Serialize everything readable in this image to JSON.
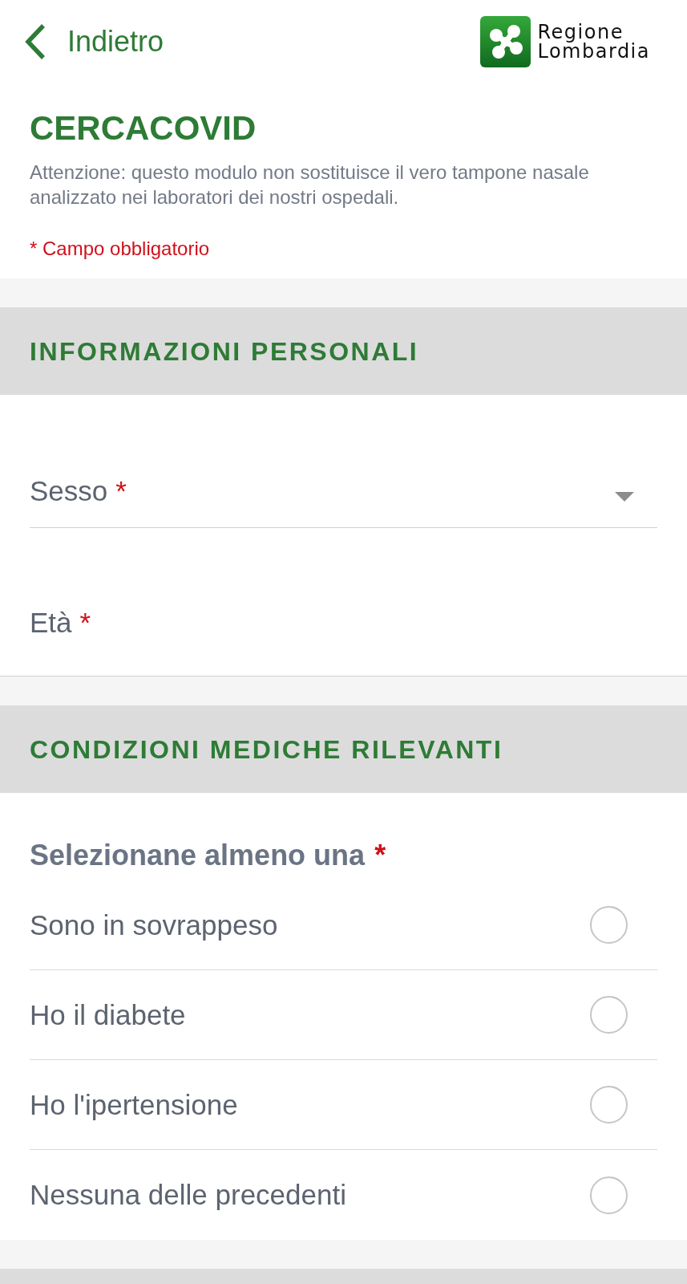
{
  "header": {
    "back_label": "Indietro",
    "logo_lines": [
      "Regione",
      "Lombardia"
    ]
  },
  "intro": {
    "title": "CERCACOVID",
    "notice": "Attenzione: questo modulo non sostituisce il vero tampone nasale analizzato nei laboratori dei nostri ospedali.",
    "required_note": "* Campo obbligatorio"
  },
  "sections": [
    {
      "title": "INFORMAZIONI PERSONALI",
      "fields": [
        {
          "kind": "select",
          "label": "Sesso",
          "required_mark": "*"
        },
        {
          "kind": "text",
          "label": "Età",
          "required_mark": "*"
        }
      ]
    },
    {
      "title": "CONDIZIONI MEDICHE RILEVANTI",
      "question": {
        "text": "Selezionane almeno una",
        "required_mark": "*"
      },
      "options": [
        {
          "label": "Sono in sovrappeso",
          "checked": false
        },
        {
          "label": "Ho il diabete",
          "checked": false
        },
        {
          "label": "Ho l'ipertensione",
          "checked": false
        },
        {
          "label": "Nessuna delle precedenti",
          "checked": false
        }
      ]
    }
  ]
}
